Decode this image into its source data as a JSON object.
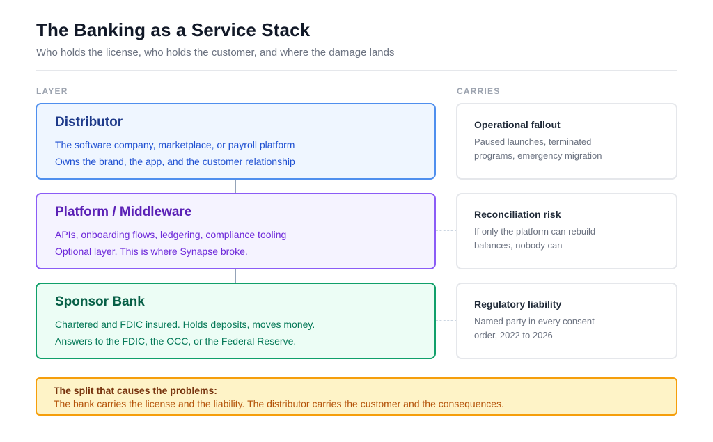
{
  "header": {
    "title": "The Banking as a Service Stack",
    "subtitle": "Who holds the license, who holds the customer, and where the damage lands"
  },
  "columns": {
    "layer_label": "LAYER",
    "carries_label": "CARRIES"
  },
  "layers": [
    {
      "name": "Distributor",
      "line1": "The software company, marketplace, or payroll platform",
      "line2": "Owns the brand, the app, and the customer relationship",
      "border_color": "#4f8fee",
      "fill_color": "#eff6ff"
    },
    {
      "name": "Platform / Middleware",
      "line1": "APIs, onboarding flows, ledgering, compliance tooling",
      "line2": "Optional layer. This is where Synapse broke.",
      "border_color": "#8b5cf6",
      "fill_color": "#f5f3ff"
    },
    {
      "name": "Sponsor Bank",
      "line1": "Chartered and FDIC insured. Holds deposits, moves money.",
      "line2": "Answers to the FDIC, the OCC, or the Federal Reserve.",
      "border_color": "#10a06a",
      "fill_color": "#ecfdf5"
    }
  ],
  "carries": [
    {
      "title": "Operational fallout",
      "line1": "Paused launches, terminated",
      "line2": "programs, emergency migration"
    },
    {
      "title": "Reconciliation risk",
      "line1": "If only the platform can rebuild",
      "line2": "balances, nobody can"
    },
    {
      "title": "Regulatory liability",
      "line1": "Named party in every consent",
      "line2": "order, 2022 to 2026"
    }
  ],
  "callout": {
    "title": "The split that causes the problems:",
    "text": "The bank carries the license and the liability. The distributor carries the customer and the consequences.",
    "border_color": "#f59e0b",
    "fill_color": "#fef3c7"
  }
}
